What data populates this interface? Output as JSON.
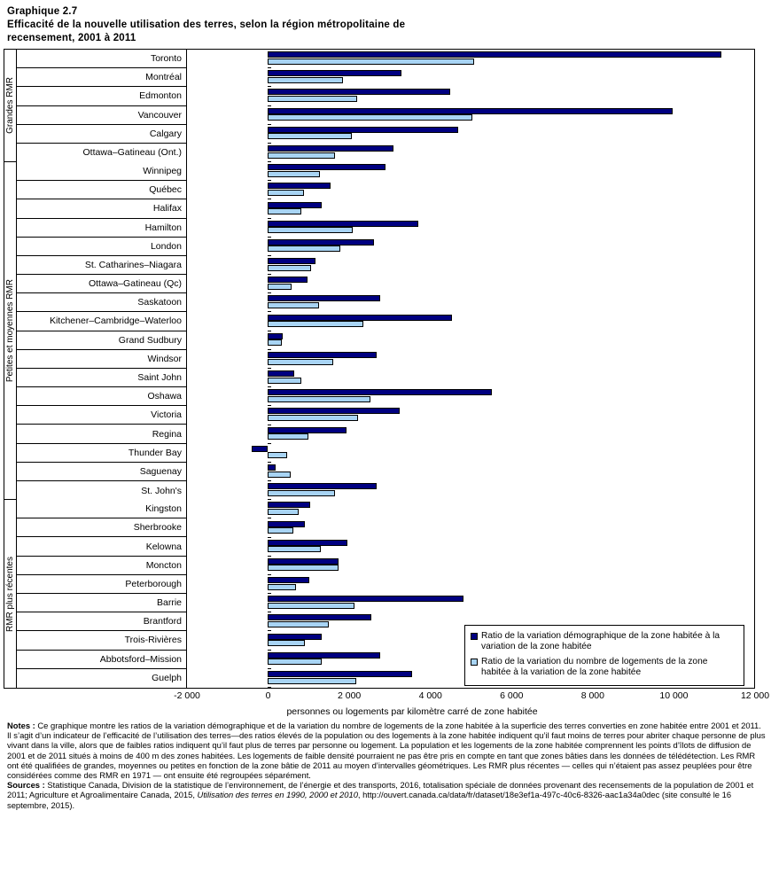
{
  "header": {
    "chart_number": "Graphique  2.7",
    "title_line1": "Efficacité  de la nouvelle  utilisation  des terres, selon la région  métropolitaine  de",
    "title_line2": "recensement, 2001  à 2011"
  },
  "legend": {
    "series1": "Ratio de la variation démographique de la zone habitée à la variation de la zone habitée",
    "series2": "Ratio de la variation du nombre de logements de la zone habitée à la variation de la zone habitée"
  },
  "colors": {
    "series1": "#000080",
    "series2": "#A8D4F4",
    "frame": "#000000"
  },
  "notes": {
    "notes_label": "Notes :",
    "notes_text": " Ce graphique montre les ratios de la variation démographique et de la variation du nombre de logements de la zone habitée à la superficie des terres converties en zone habitée entre 2001 et 2011. Il s’agit d’un indicateur de l’efficacité de l’utilisation des terres—des ratios élevés de la population ou des logements à la zone habitée indiquent qu’il faut moins de terres pour abriter chaque personne de plus vivant dans la ville, alors que de faibles ratios indiquent qu’il faut plus de terres par personne ou logement. La population et les logements de la zone habitée comprennent les points d’îlots de diffusion de 2001 et de 2011 situés à moins de 400 m des zones habitées. Les logements de faible densité pourraient ne pas être pris en compte en tant que zones bâties dans les données de télédétection. Les RMR ont été qualifiées de grandes, moyennes ou petites en fonction de la zone bâtie de 2011 au moyen d’intervalles géométriques. Les RMR plus récentes — celles qui n’étaient pas assez peuplées pour être considérées comme des RMR en 1971 — ont ensuite été regroupées séparément.",
    "sources_label": "Sources :",
    "sources_text1": " Statistique Canada, Division de la statistique de l’environnement, de l’énergie et des transports, 2016, totalisation spéciale de données provenant des recensements de la population de 2001 et 2011; Agriculture et Agroalimentaire Canada, 2015, ",
    "sources_italic": "Utilisation des terres en 1990, 2000 et 2010",
    "sources_text2": ", http://ouvert.canada.ca/data/fr/dataset/18e3ef1a-497c-40c6-8326-aac1a34a0dec (site consulté le 16 septembre, 2015)."
  },
  "chart_data": {
    "type": "bar",
    "orientation": "horizontal",
    "title": "Efficacité de la nouvelle utilisation des terres, selon la région métropolitaine de recensement, 2001 à 2011",
    "xlabel": "personnes ou logements par kilomètre carré de zone habitée",
    "ylabel": "",
    "xlim": [
      -2000,
      12000
    ],
    "xticks": [
      -2000,
      0,
      2000,
      4000,
      6000,
      8000,
      10000,
      12000
    ],
    "xtick_labels": [
      "-2 000",
      "0",
      "2 000",
      "4 000",
      "6 000",
      "8 000",
      "10 000",
      "12 000"
    ],
    "grid": false,
    "legend_position": "bottom-right",
    "groups": [
      {
        "name": "Grandes RMR",
        "categories": [
          "Toronto",
          "Montréal",
          "Edmonton",
          "Vancouver",
          "Calgary",
          "Ottawa–Gatineau (Ont.)"
        ],
        "series": [
          {
            "name": "Ratio de la variation démographique de la zone habitée à la variation de la zone habitée",
            "values": [
              11200,
              3300,
              4500,
              9980,
              4700,
              3100
            ]
          },
          {
            "name": "Ratio de la variation du nombre de logements de la zone habitée à la variation de la zone habitée",
            "values": [
              5080,
              1850,
              2200,
              5040,
              2060,
              1650
            ]
          }
        ]
      },
      {
        "name": "Petites et moyennes RMR",
        "categories": [
          "Winnipeg",
          "Québec",
          "Halifax",
          "Hamilton",
          "London",
          "St. Catharines–Niagara",
          "Ottawa–Gatineau (Qc)",
          "Saskatoon",
          "Kitchener–Cambridge–Waterloo",
          "Grand Sudbury",
          "Windsor",
          "Saint John",
          "Oshawa",
          "Victoria",
          "Regina",
          "Thunder Bay",
          "Saguenay",
          "St. John's"
        ],
        "series": [
          {
            "name": "Ratio de la variation démographique de la zone habitée à la variation de la zone habitée",
            "values": [
              2900,
              1540,
              1330,
              3700,
              2620,
              1180,
              980,
              2760,
              4540,
              370,
              2680,
              640,
              5530,
              3240,
              1930,
              -400,
              180,
              2680
            ]
          },
          {
            "name": "Ratio de la variation du nombre de logements de la zone habitée à la variation de la zone habitée",
            "values": [
              1280,
              880,
              830,
              2080,
              1780,
              1070,
              590,
              1250,
              2350,
              330,
              1600,
              820,
              2520,
              2230,
              1000,
              480,
              570,
              1660
            ]
          }
        ]
      },
      {
        "name": "RMR plus récentes",
        "categories": [
          "Kingston",
          "Sherbrooke",
          "Kelowna",
          "Moncton",
          "Peterborough",
          "Barrie",
          "Brantford",
          "Trois-Rivières",
          "Abbotsford–Mission",
          "Guelph"
        ],
        "series": [
          {
            "name": "Ratio de la variation démographique de la zone habitée à la variation de la zone habitée",
            "values": [
              1050,
              900,
              1960,
              1750,
              1020,
              4830,
              2550,
              1330,
              2770,
              3550
            ]
          },
          {
            "name": "Ratio de la variation du nombre de logements de la zone habitée à la variation de la zone habitée",
            "values": [
              760,
              630,
              1300,
              1730,
              700,
              2130,
              1500,
              900,
              1330,
              2180
            ]
          }
        ]
      }
    ]
  }
}
